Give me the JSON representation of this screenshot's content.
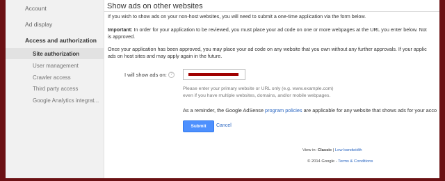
{
  "sidebar": {
    "top_items": [
      "Account",
      "Ad display"
    ],
    "group_label": "Access and authorization",
    "items": [
      {
        "label": "Site authorization",
        "active": true
      },
      {
        "label": "User management",
        "active": false
      },
      {
        "label": "Crawler access",
        "active": false
      },
      {
        "label": "Third party access",
        "active": false
      },
      {
        "label": "Google Analytics integrat...",
        "active": false
      }
    ]
  },
  "main": {
    "title": "Show ads on other websites",
    "intro": "If you wish to show ads on your non-host websites, you will need to submit a one-time application via the form below.",
    "important_label": "Important:",
    "important_line1": "In order for your application to be reviewed, you must place your ad code on one or more webpages at the URL you enter below. Not",
    "important_line2": "is approved.",
    "approved_line1": "Once your application has been approved, you may place your ad code on any website that you own without any further approvals. If your applic",
    "approved_line2": "ads on host sites and may apply again in the future.",
    "site_label": "I will show ads on:",
    "help_icon_glyph": "?",
    "site_input_value": "",
    "hint_line1": "Please enter your primary website or URL only (e.g. www.example.com)",
    "hint_line2": "even if you have multiple websites, domains, and/or mobile webpages.",
    "reminder_before": "As a reminder, the Google AdSense ",
    "reminder_link": "program policies",
    "reminder_after": " are applicable for any website that shows ads for your acco",
    "submit_label": "Submit",
    "cancel_label": "Cancel"
  },
  "footer": {
    "view_in_label": "View in:",
    "view_classic": "Classic",
    "separator": "|",
    "low_bandwidth": "Low bandwidth",
    "copyright": "© 2014 Google",
    "dash": "-",
    "terms_link": "Terms & Conditions"
  },
  "colors": {
    "accent": "#4d90fe",
    "link": "#2a66c1",
    "page_border": "#6b1114",
    "input_value_redaction": "#a00000"
  }
}
